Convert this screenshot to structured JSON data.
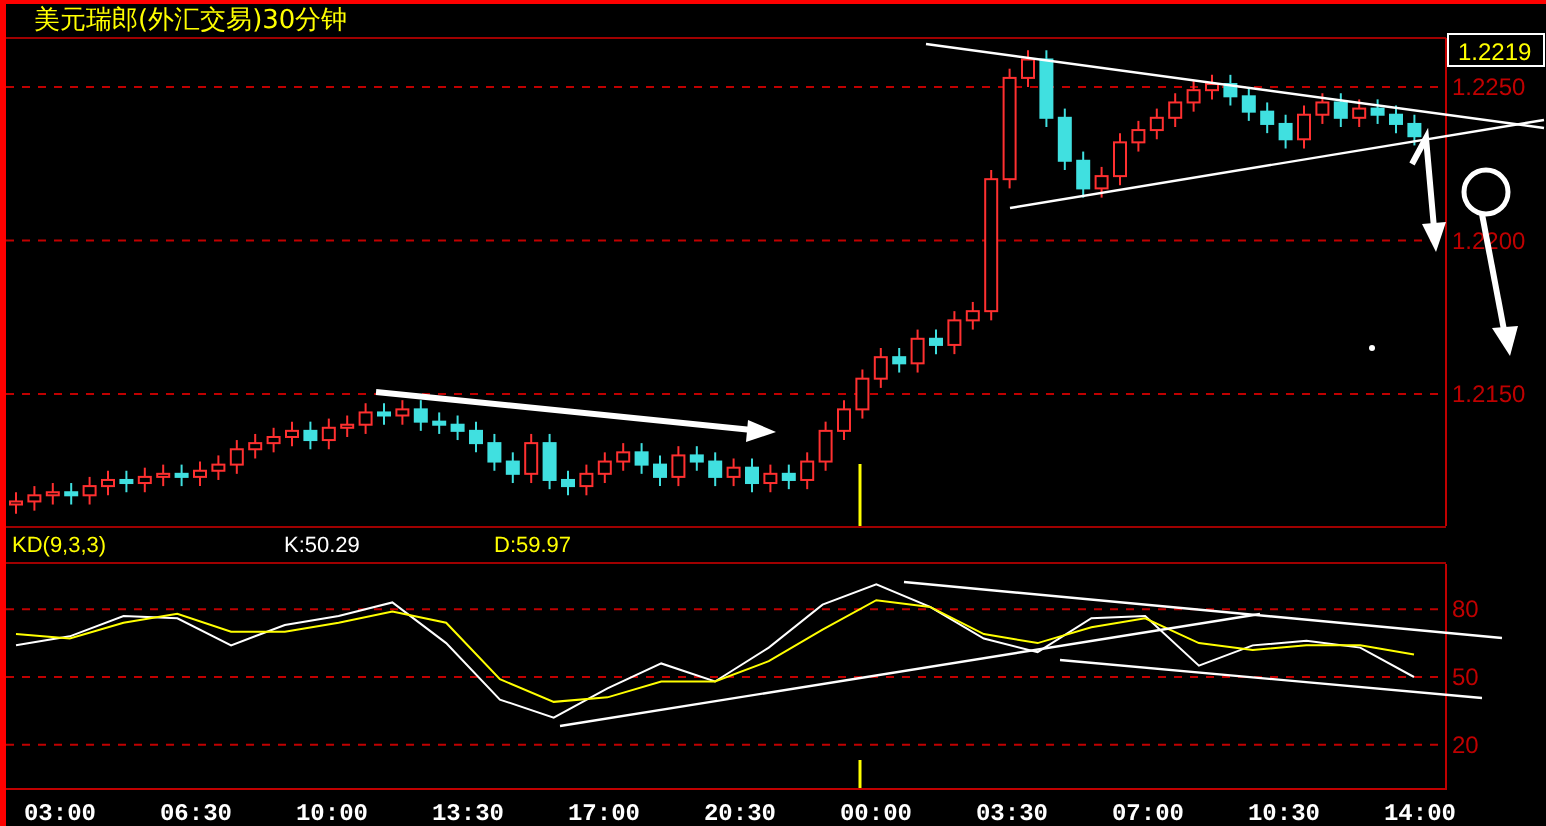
{
  "title": "美元瑞郎(外汇交易)30分钟",
  "price_chart": {
    "current_price": "1.2219",
    "chart_data": {
      "type": "candlestick",
      "ylim": [
        1.2107,
        1.2266
      ],
      "yticks": [
        {
          "value": 1.225,
          "label": "1.2250"
        },
        {
          "value": 1.22,
          "label": "1.2200"
        },
        {
          "value": 1.215,
          "label": "1.2150"
        }
      ],
      "grid": true,
      "ohlc": [
        [
          1.2114,
          1.2118,
          1.2111,
          1.2115
        ],
        [
          1.2115,
          1.212,
          1.2112,
          1.2117
        ],
        [
          1.2117,
          1.2121,
          1.2114,
          1.2118
        ],
        [
          1.2118,
          1.2121,
          1.2114,
          1.2117
        ],
        [
          1.2117,
          1.2123,
          1.2114,
          1.212
        ],
        [
          1.212,
          1.2125,
          1.2117,
          1.2122
        ],
        [
          1.2122,
          1.2125,
          1.2118,
          1.2121
        ],
        [
          1.2121,
          1.2126,
          1.2118,
          1.2123
        ],
        [
          1.2123,
          1.2127,
          1.212,
          1.2124
        ],
        [
          1.2124,
          1.2127,
          1.212,
          1.2123
        ],
        [
          1.2123,
          1.2128,
          1.212,
          1.2125
        ],
        [
          1.2125,
          1.213,
          1.2122,
          1.2127
        ],
        [
          1.2127,
          1.2135,
          1.2124,
          1.2132
        ],
        [
          1.2132,
          1.2137,
          1.2129,
          1.2134
        ],
        [
          1.2134,
          1.2139,
          1.2131,
          1.2136
        ],
        [
          1.2136,
          1.2141,
          1.2133,
          1.2138
        ],
        [
          1.2138,
          1.2141,
          1.2132,
          1.2135
        ],
        [
          1.2135,
          1.2142,
          1.2132,
          1.2139
        ],
        [
          1.2139,
          1.2143,
          1.2136,
          1.214
        ],
        [
          1.214,
          1.2147,
          1.2137,
          1.2144
        ],
        [
          1.2144,
          1.2147,
          1.214,
          1.2143
        ],
        [
          1.2143,
          1.2148,
          1.214,
          1.2145
        ],
        [
          1.2145,
          1.2148,
          1.2138,
          1.2141
        ],
        [
          1.2141,
          1.2144,
          1.2137,
          1.214
        ],
        [
          1.214,
          1.2143,
          1.2135,
          1.2138
        ],
        [
          1.2138,
          1.2141,
          1.2131,
          1.2134
        ],
        [
          1.2134,
          1.2137,
          1.2125,
          1.2128
        ],
        [
          1.2128,
          1.2131,
          1.2121,
          1.2124
        ],
        [
          1.2124,
          1.2137,
          1.2121,
          1.2134
        ],
        [
          1.2134,
          1.2137,
          1.2119,
          1.2122
        ],
        [
          1.2122,
          1.2125,
          1.2117,
          1.212
        ],
        [
          1.212,
          1.2127,
          1.2117,
          1.2124
        ],
        [
          1.2124,
          1.2131,
          1.2121,
          1.2128
        ],
        [
          1.2128,
          1.2134,
          1.2125,
          1.2131
        ],
        [
          1.2131,
          1.2134,
          1.2124,
          1.2127
        ],
        [
          1.2127,
          1.213,
          1.212,
          1.2123
        ],
        [
          1.2123,
          1.2133,
          1.212,
          1.213
        ],
        [
          1.213,
          1.2133,
          1.2125,
          1.2128
        ],
        [
          1.2128,
          1.2131,
          1.212,
          1.2123
        ],
        [
          1.2123,
          1.2129,
          1.212,
          1.2126
        ],
        [
          1.2126,
          1.2129,
          1.2118,
          1.2121
        ],
        [
          1.2121,
          1.2127,
          1.2118,
          1.2124
        ],
        [
          1.2124,
          1.2127,
          1.2119,
          1.2122
        ],
        [
          1.2122,
          1.2131,
          1.2119,
          1.2128
        ],
        [
          1.2128,
          1.2141,
          1.2125,
          1.2138
        ],
        [
          1.2138,
          1.2148,
          1.2135,
          1.2145
        ],
        [
          1.2145,
          1.2158,
          1.2142,
          1.2155
        ],
        [
          1.2155,
          1.2165,
          1.2152,
          1.2162
        ],
        [
          1.2162,
          1.2165,
          1.2157,
          1.216
        ],
        [
          1.216,
          1.2171,
          1.2157,
          1.2168
        ],
        [
          1.2168,
          1.2171,
          1.2163,
          1.2166
        ],
        [
          1.2166,
          1.2177,
          1.2163,
          1.2174
        ],
        [
          1.2174,
          1.218,
          1.2171,
          1.2177
        ],
        [
          1.2177,
          1.2223,
          1.2174,
          1.222
        ],
        [
          1.222,
          1.2256,
          1.2217,
          1.2253
        ],
        [
          1.2253,
          1.2262,
          1.225,
          1.2259
        ],
        [
          1.2259,
          1.2262,
          1.2237,
          1.224
        ],
        [
          1.224,
          1.2243,
          1.2223,
          1.2226
        ],
        [
          1.2226,
          1.2229,
          1.2214,
          1.2217
        ],
        [
          1.2217,
          1.2224,
          1.2214,
          1.2221
        ],
        [
          1.2221,
          1.2235,
          1.2218,
          1.2232
        ],
        [
          1.2232,
          1.2239,
          1.2229,
          1.2236
        ],
        [
          1.2236,
          1.2243,
          1.2233,
          1.224
        ],
        [
          1.224,
          1.2248,
          1.2237,
          1.2245
        ],
        [
          1.2245,
          1.2252,
          1.2242,
          1.2249
        ],
        [
          1.2249,
          1.2254,
          1.2246,
          1.2251
        ],
        [
          1.2251,
          1.2254,
          1.2244,
          1.2247
        ],
        [
          1.2247,
          1.225,
          1.2239,
          1.2242
        ],
        [
          1.2242,
          1.2245,
          1.2235,
          1.2238
        ],
        [
          1.2238,
          1.2241,
          1.223,
          1.2233
        ],
        [
          1.2233,
          1.2244,
          1.223,
          1.2241
        ],
        [
          1.2241,
          1.2248,
          1.2238,
          1.2245
        ],
        [
          1.2245,
          1.2248,
          1.2237,
          1.224
        ],
        [
          1.224,
          1.2246,
          1.2237,
          1.2243
        ],
        [
          1.2243,
          1.2246,
          1.2238,
          1.2241
        ],
        [
          1.2241,
          1.2244,
          1.2235,
          1.2238
        ],
        [
          1.2238,
          1.2241,
          1.2231,
          1.2234
        ]
      ]
    }
  },
  "indicator": {
    "name": "KD(9,3,3)",
    "k": "K:50.29",
    "d": "D:59.97",
    "chart_data": {
      "type": "line",
      "ylim": [
        0,
        100
      ],
      "yticks": [
        {
          "value": 80,
          "label": "80"
        },
        {
          "value": 50,
          "label": "50"
        },
        {
          "value": 20,
          "label": "20"
        }
      ],
      "grid": true,
      "series": [
        {
          "color": "#ffffff",
          "values": [
            64,
            68,
            77,
            76,
            64,
            73,
            77,
            83,
            65,
            40,
            32,
            45,
            56,
            48,
            63,
            82,
            91,
            81,
            67,
            61,
            76,
            77,
            55,
            64,
            66,
            63,
            50
          ]
        },
        {
          "color": "#ffff00",
          "values": [
            69,
            67,
            74,
            78,
            70,
            70,
            74,
            79,
            74,
            49,
            39,
            41,
            48,
            48,
            57,
            71,
            84,
            81,
            69,
            65,
            72,
            76,
            65,
            62,
            64,
            64,
            60
          ]
        }
      ]
    }
  },
  "time_axis": [
    "03:00",
    "06:30",
    "10:00",
    "13:30",
    "17:00",
    "20:30",
    "00:00",
    "03:30",
    "07:00",
    "10:30",
    "14:00"
  ]
}
